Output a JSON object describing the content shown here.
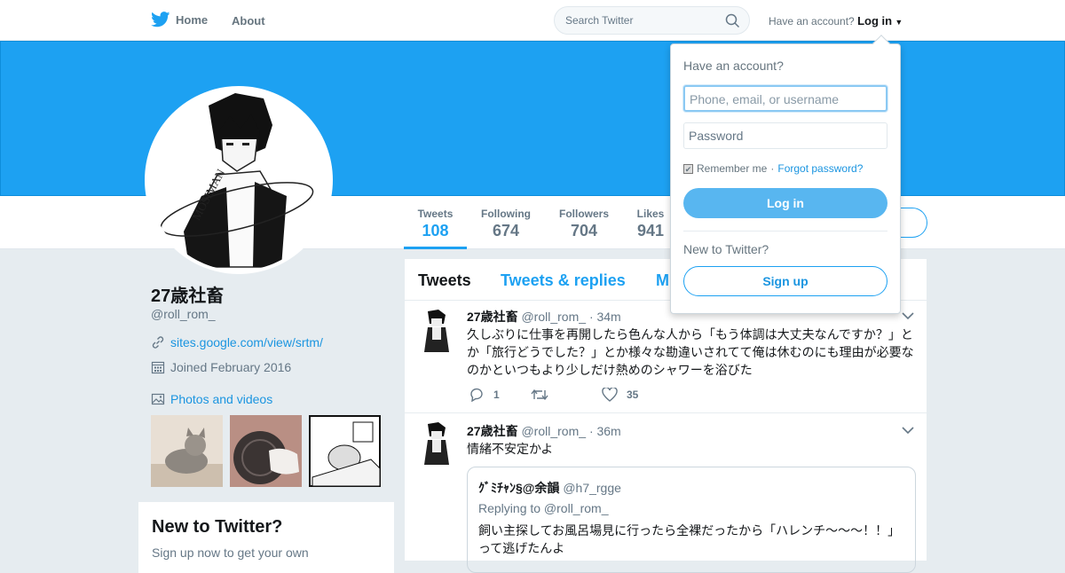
{
  "topnav": {
    "home_label": "Home",
    "about_label": "About",
    "search_placeholder": "Search Twitter",
    "have_account": "Have an account?",
    "login_label": "Log in"
  },
  "profile": {
    "name": "27歳社畜",
    "handle": "@roll_rom_",
    "website": "sites.google.com/view/srtm/",
    "joined": "Joined February 2016",
    "photos_label": "Photos and videos"
  },
  "stats": [
    {
      "label": "Tweets",
      "value": "108"
    },
    {
      "label": "Following",
      "value": "674"
    },
    {
      "label": "Followers",
      "value": "704"
    },
    {
      "label": "Likes",
      "value": "941"
    }
  ],
  "timeline": {
    "tabs": [
      "Tweets",
      "Tweets & replies",
      "M"
    ],
    "tweets": [
      {
        "name": "27歳社畜",
        "handle": "@roll_rom_",
        "time": "· 34m",
        "text": "久しぶりに仕事を再開したら色んな人から「もう体調は大丈夫なんですか？」とか「旅行どうでした？」とか様々な勘違いされてて俺は休むのにも理由が必要なのかといつもより少しだけ熱めのシャワーを浴びた",
        "replies": "1",
        "retweets": "",
        "likes": "35"
      },
      {
        "name": "27歳社畜",
        "handle": "@roll_rom_",
        "time": "· 36m",
        "text": "情緒不安定かよ",
        "quote": {
          "name": "ｸﾞﾐﾁｬﾝ§@余韻",
          "handle": "@h7_rgge",
          "replying": "Replying to @roll_rom_",
          "text": "飼い主探してお風呂場見に行ったら全裸だったから「ハレンチ～～～！！」って逃げたんよ"
        }
      }
    ]
  },
  "sidebar_box": {
    "title": "New to Twitter?",
    "text": "Sign up now to get your own"
  },
  "login_dropdown": {
    "title": "Have an account?",
    "username_placeholder": "Phone, email, or username",
    "password_placeholder": "Password",
    "remember": "Remember me",
    "forgot": "Forgot password?",
    "login_button": "Log in",
    "new_to": "New to Twitter?",
    "signup_button": "Sign up"
  },
  "colors": {
    "brand": "#1da1f2",
    "link": "#1b95e0",
    "background": "#e6ecf0"
  }
}
